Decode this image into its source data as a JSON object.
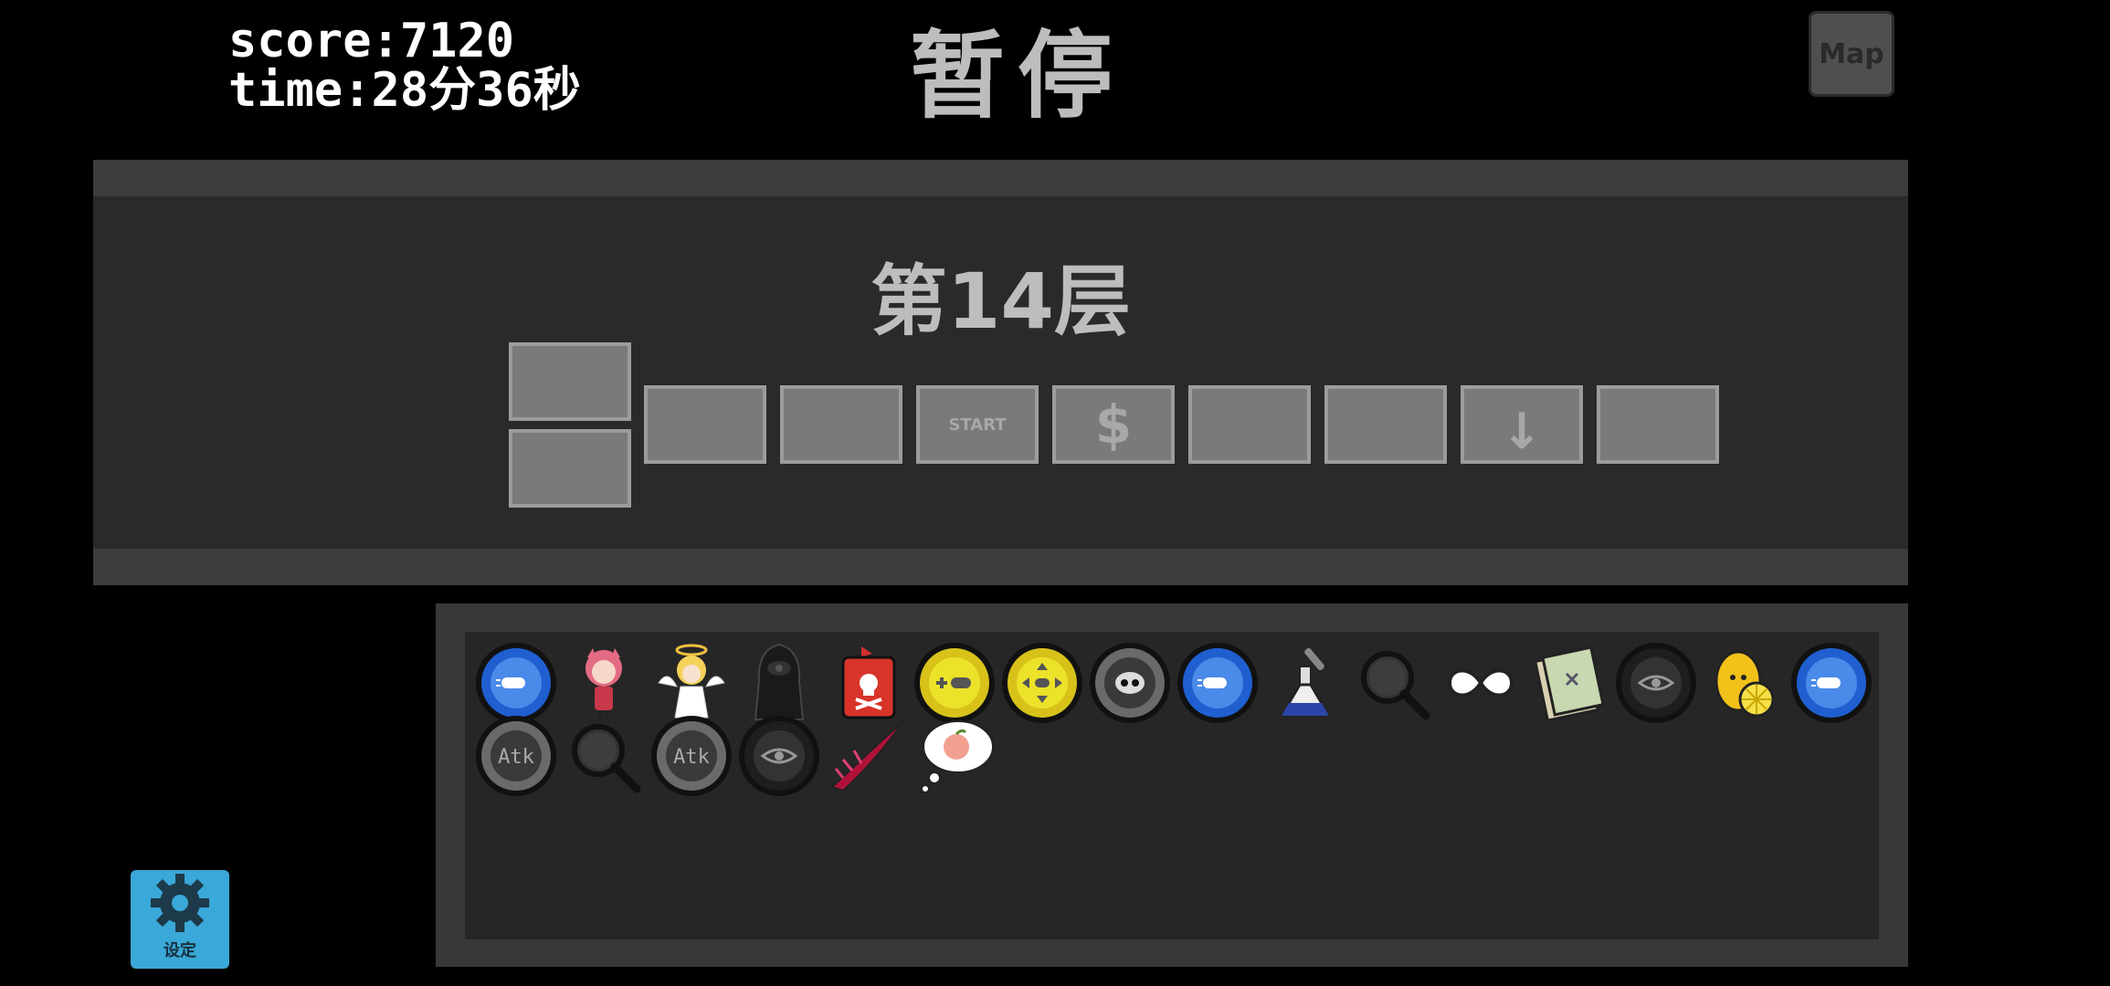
{
  "hud": {
    "score_text": "score:7120",
    "time_text": "time:28分36秒"
  },
  "pause_title": "暂停",
  "map_button": {
    "label": "Map"
  },
  "floor": {
    "title": "第14层",
    "rooms": [
      {
        "label": "",
        "current": true
      },
      {
        "label": "",
        "current": true
      },
      {
        "label": ""
      },
      {
        "label": ""
      },
      {
        "label": "START"
      },
      {
        "label": "$"
      },
      {
        "label": ""
      },
      {
        "label": ""
      },
      {
        "label": "↓"
      },
      {
        "label": ""
      }
    ]
  },
  "items": [
    {
      "name": "blue-bullet-coin-icon"
    },
    {
      "name": "pink-haired-girl-icon"
    },
    {
      "name": "angel-icon"
    },
    {
      "name": "hooded-ghost-icon"
    },
    {
      "name": "poison-bottle-icon"
    },
    {
      "name": "yellow-plus-bullet-coin-icon"
    },
    {
      "name": "yellow-arrows-coin-icon"
    },
    {
      "name": "grey-mask-coin-icon"
    },
    {
      "name": "blue-bullet-coin-icon"
    },
    {
      "name": "flask-icon"
    },
    {
      "name": "magnifier-icon"
    },
    {
      "name": "infinity-icon"
    },
    {
      "name": "book-icon"
    },
    {
      "name": "eye-coin-icon"
    },
    {
      "name": "lemon-icon"
    },
    {
      "name": "blue-bullet-coin-icon"
    },
    {
      "name": "atk-coin-icon",
      "label": "Atk"
    },
    {
      "name": "magnifier-icon"
    },
    {
      "name": "atk-coin-icon",
      "label": "Atk"
    },
    {
      "name": "eye-coin-icon"
    },
    {
      "name": "red-feather-icon"
    },
    {
      "name": "peach-thought-icon"
    }
  ],
  "settings": {
    "label": "设定"
  },
  "colors": {
    "background": "#000000",
    "panel": "#2a2a2a",
    "current_room": "#a8a8a8",
    "settings_button": "#3aa8d8"
  }
}
